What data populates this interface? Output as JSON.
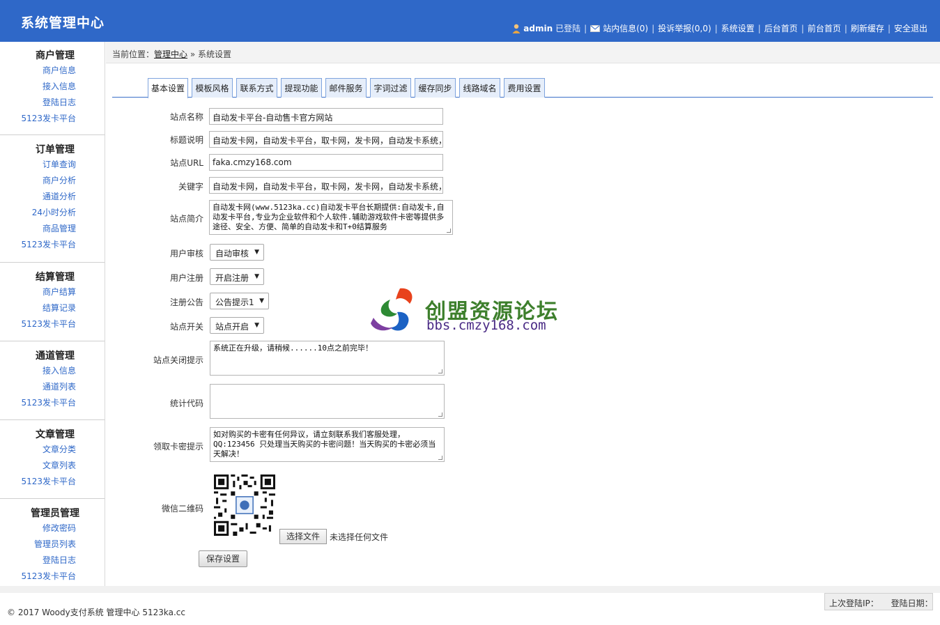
{
  "header": {
    "title": "系统管理中心",
    "user": "admin",
    "logged_text": "已登陆",
    "links": [
      "站内信息(0)",
      "投诉举报(0,0)",
      "系统设置",
      "后台首页",
      "前台首页",
      "刷新缓存",
      "安全退出"
    ]
  },
  "sidebar": {
    "groups": [
      {
        "title": "商户管理",
        "items": [
          "商户信息",
          "接入信息",
          "登陆日志",
          "5123发卡平台"
        ]
      },
      {
        "title": "订单管理",
        "items": [
          "订单查询",
          "商户分析",
          "通道分析",
          "24小时分析",
          "商品管理",
          "5123发卡平台"
        ]
      },
      {
        "title": "结算管理",
        "items": [
          "商户结算",
          "结算记录",
          "5123发卡平台"
        ]
      },
      {
        "title": "通道管理",
        "items": [
          "接入信息",
          "通道列表",
          "5123发卡平台"
        ]
      },
      {
        "title": "文章管理",
        "items": [
          "文章分类",
          "文章列表",
          "5123发卡平台"
        ]
      },
      {
        "title": "管理员管理",
        "items": [
          "修改密码",
          "管理员列表",
          "登陆日志",
          "5123发卡平台"
        ]
      }
    ]
  },
  "breadcrumb": {
    "prefix": "当前位置：",
    "link": "管理中心",
    "separator": " » ",
    "current": "系统设置"
  },
  "tabs": [
    "基本设置",
    "模板风格",
    "联系方式",
    "提现功能",
    "邮件服务",
    "字词过滤",
    "缓存同步",
    "线路域名",
    "费用设置"
  ],
  "form": {
    "site_name": {
      "label": "站点名称",
      "value": "自动发卡平台-自动售卡官方网站"
    },
    "title_desc": {
      "label": "标题说明",
      "value": "自动发卡网，自动发卡平台，取卡网，发卡网，自动发卡系统，"
    },
    "site_url": {
      "label": "站点URL",
      "value": "faka.cmzy168.com"
    },
    "keywords": {
      "label": "关键字",
      "value": "自动发卡网，自动发卡平台，取卡网，发卡网，自动发卡系统，"
    },
    "site_intro": {
      "label": "站点简介",
      "value": "自动发卡网(www.5123ka.cc)自动发卡平台长期提供:自动发卡,自动发卡平台,专业为企业软件和个人软件.辅助游戏软件卡密等提供多途径、安全、方便、简单的自动发卡和T+0结算服务"
    },
    "user_review": {
      "label": "用户审核",
      "value": "自动审核"
    },
    "user_register": {
      "label": "用户注册",
      "value": "开启注册"
    },
    "register_notice": {
      "label": "注册公告",
      "value": "公告提示1"
    },
    "site_switch": {
      "label": "站点开关",
      "value": "站点开启"
    },
    "close_tip": {
      "label": "站点关闭提示",
      "value": "系统正在升级，请稍候......10点之前完毕！"
    },
    "stats_code": {
      "label": "统计代码",
      "value": ""
    },
    "card_tip": {
      "label": "领取卡密提示",
      "value": "如对购买的卡密有任何异议，请立刻联系我们客服处理，QQ:123456 只处理当天购买的卡密问题！当天购买的卡密必须当天解决！"
    },
    "wechat_qr": {
      "label": "微信二维码"
    },
    "file_button": "选择文件",
    "file_status": "未选择任何文件",
    "save_button": "保存设置"
  },
  "watermark": {
    "text": "创盟资源论坛",
    "url": "bbs.cmzy168.com"
  },
  "footer": {
    "copyright": "© 2017 Woody支付系统 管理中心 5123ka.cc",
    "last_ip_label": "上次登陆IP：",
    "login_date_label": "登陆日期："
  },
  "colors": {
    "header_bg": "#2f68c8",
    "link": "#2f68c8",
    "tab_border": "#7fa4de"
  }
}
